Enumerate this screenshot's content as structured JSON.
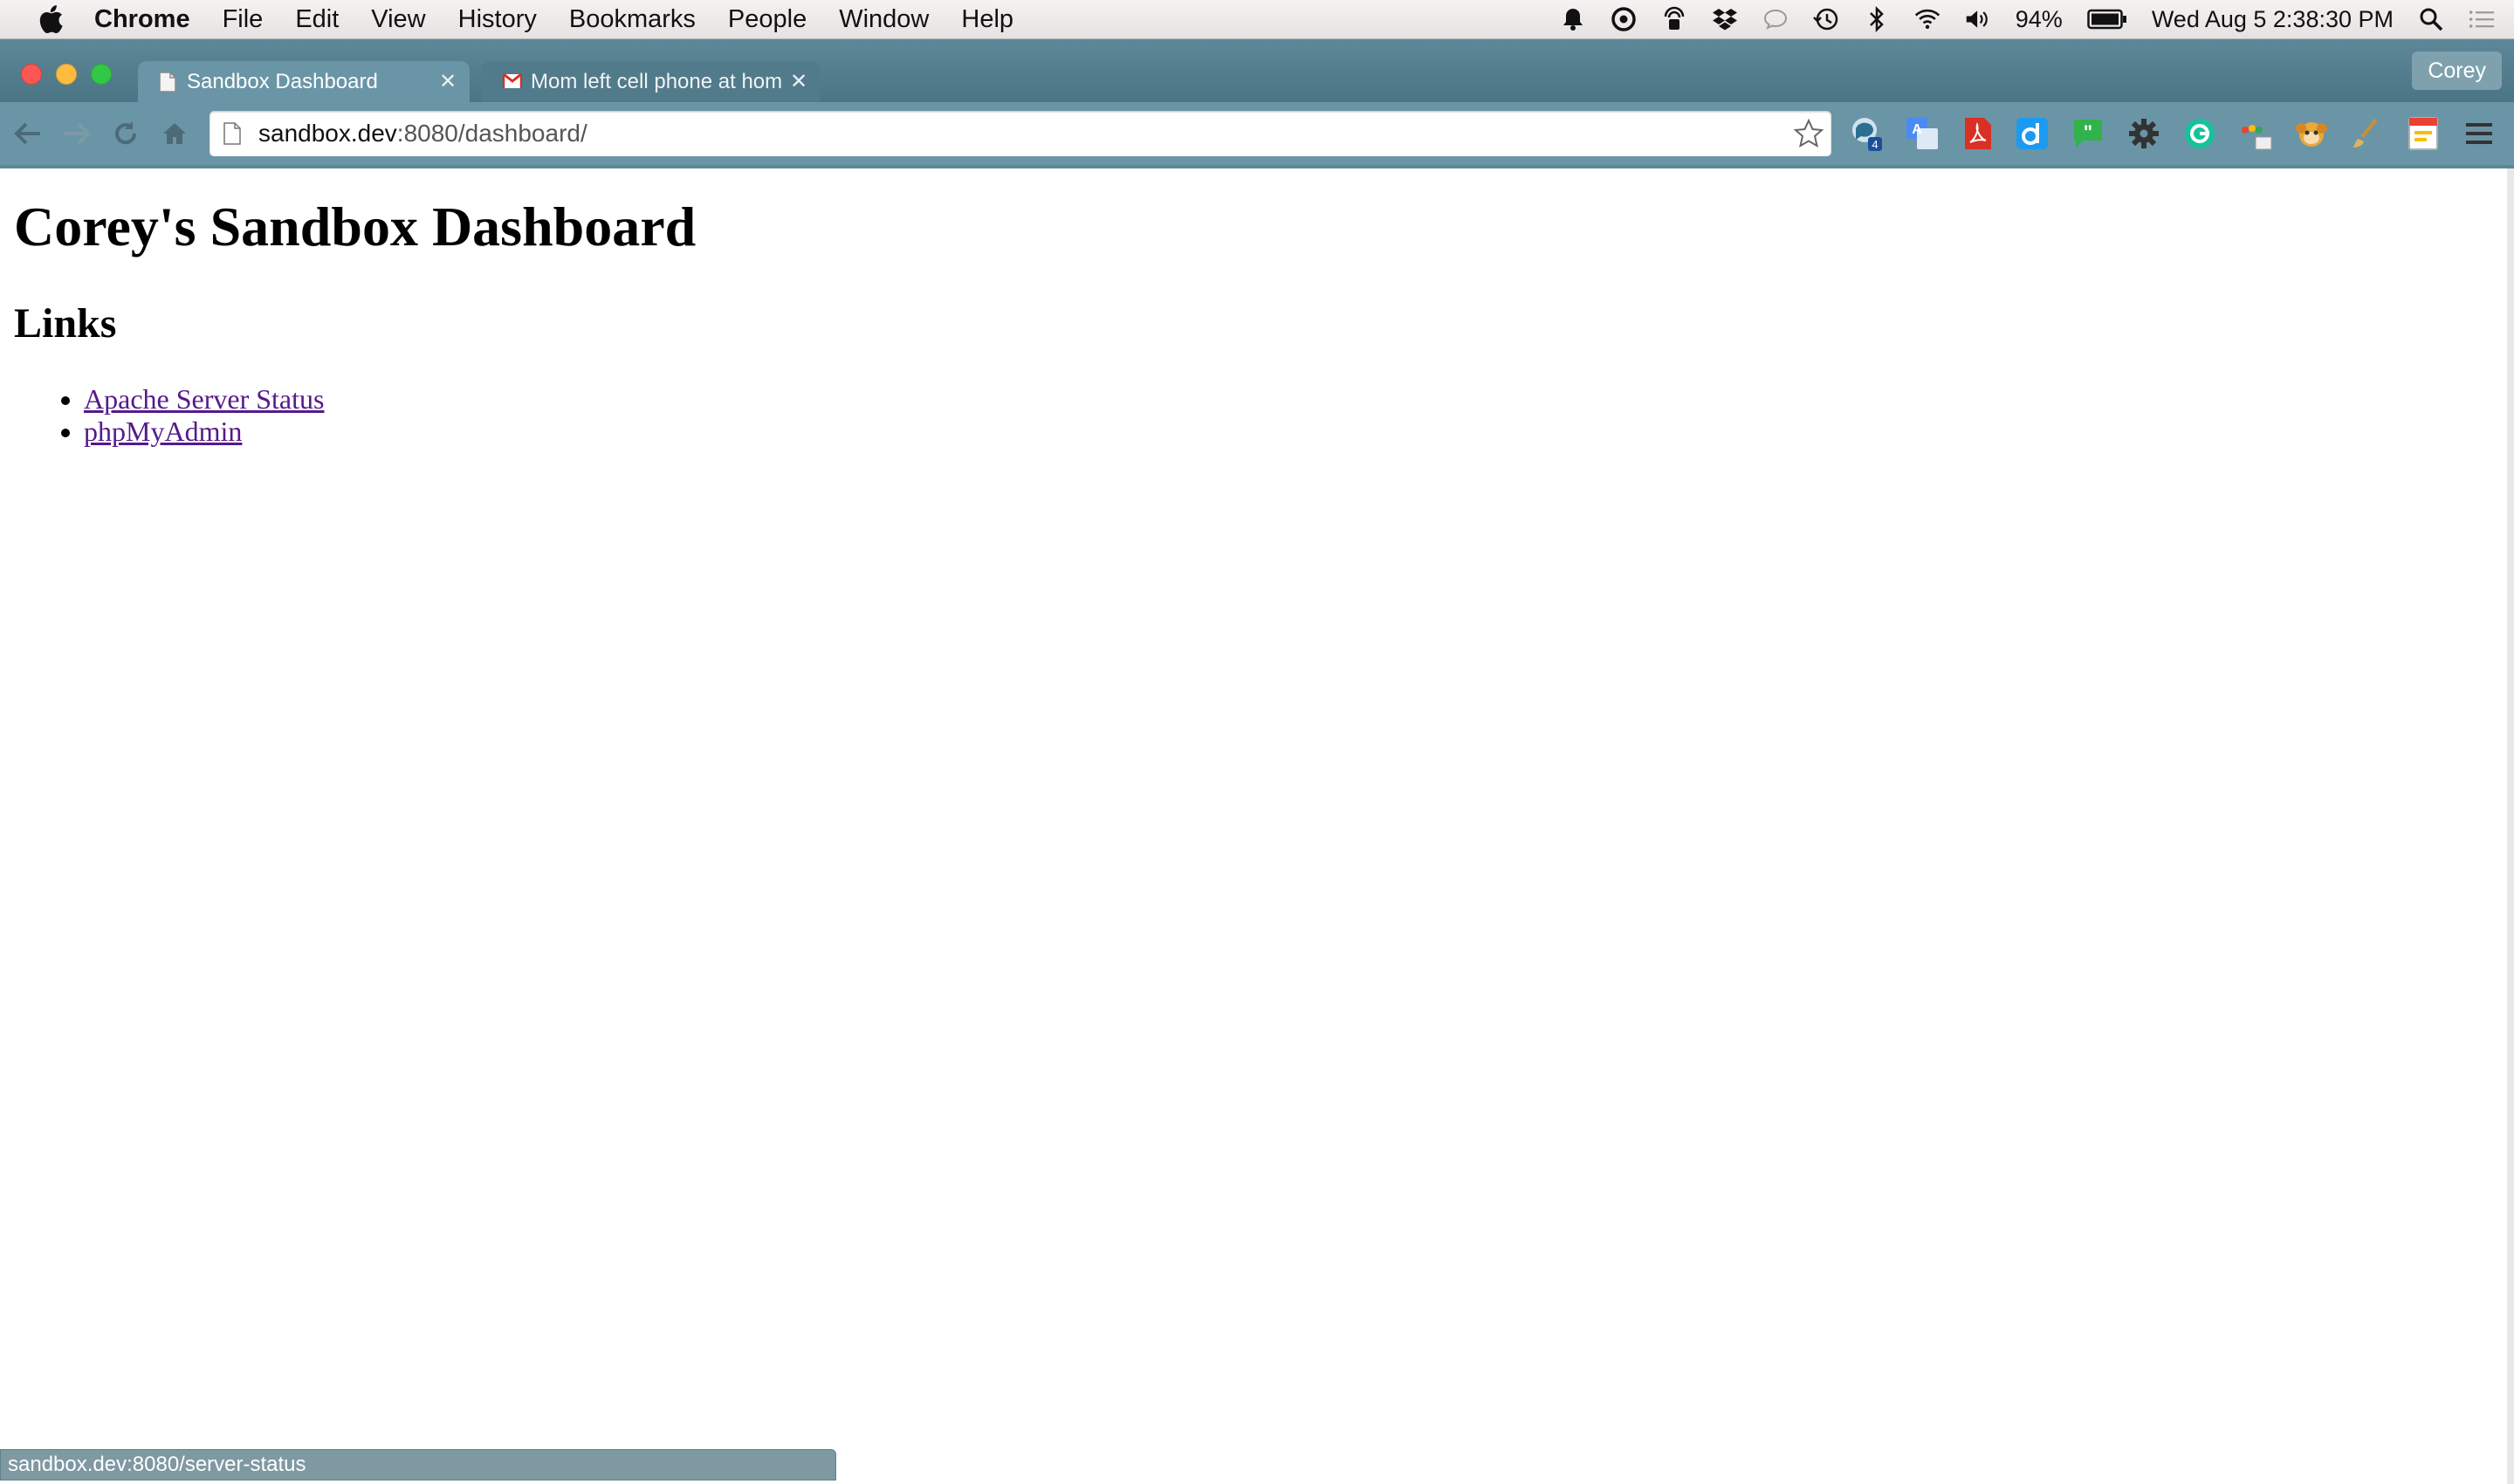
{
  "menubar": {
    "app_name": "Chrome",
    "menus": [
      "File",
      "Edit",
      "View",
      "History",
      "Bookmarks",
      "People",
      "Window",
      "Help"
    ],
    "battery": "94%",
    "clock": "Wed Aug 5  2:38:30 PM"
  },
  "tabs": [
    {
      "title": "Sandbox Dashboard",
      "favicon": "page-icon",
      "active": true
    },
    {
      "title": "Mom left cell phone at hom",
      "favicon": "gmail-icon",
      "active": false
    }
  ],
  "profile_name": "Corey",
  "address_bar": {
    "host": "sandbox.dev",
    "path": ":8080/dashboard/"
  },
  "extensions": [
    {
      "name": "ext-chat-icon",
      "badge": "4"
    },
    {
      "name": "ext-translate-icon",
      "badge": ""
    },
    {
      "name": "ext-pdf-icon",
      "badge": ""
    },
    {
      "name": "ext-d-icon",
      "badge": ""
    },
    {
      "name": "ext-quote-icon",
      "badge": ""
    },
    {
      "name": "ext-gear-icon",
      "badge": ""
    },
    {
      "name": "ext-grammarly-icon",
      "badge": ""
    },
    {
      "name": "ext-camera-icon",
      "badge": ""
    },
    {
      "name": "ext-monkey-icon",
      "badge": ""
    },
    {
      "name": "ext-brush-icon",
      "badge": ""
    },
    {
      "name": "ext-note-icon",
      "badge": ""
    }
  ],
  "page": {
    "heading": "Corey's Sandbox Dashboard",
    "subheading": "Links",
    "links": [
      {
        "label": "Apache Server Status"
      },
      {
        "label": "phpMyAdmin"
      }
    ]
  },
  "status_bar": "sandbox.dev:8080/server-status",
  "colors": {
    "chrome_frame": "#5e8797",
    "toolbar": "#6a95a6",
    "visited_link": "#551a8b"
  }
}
